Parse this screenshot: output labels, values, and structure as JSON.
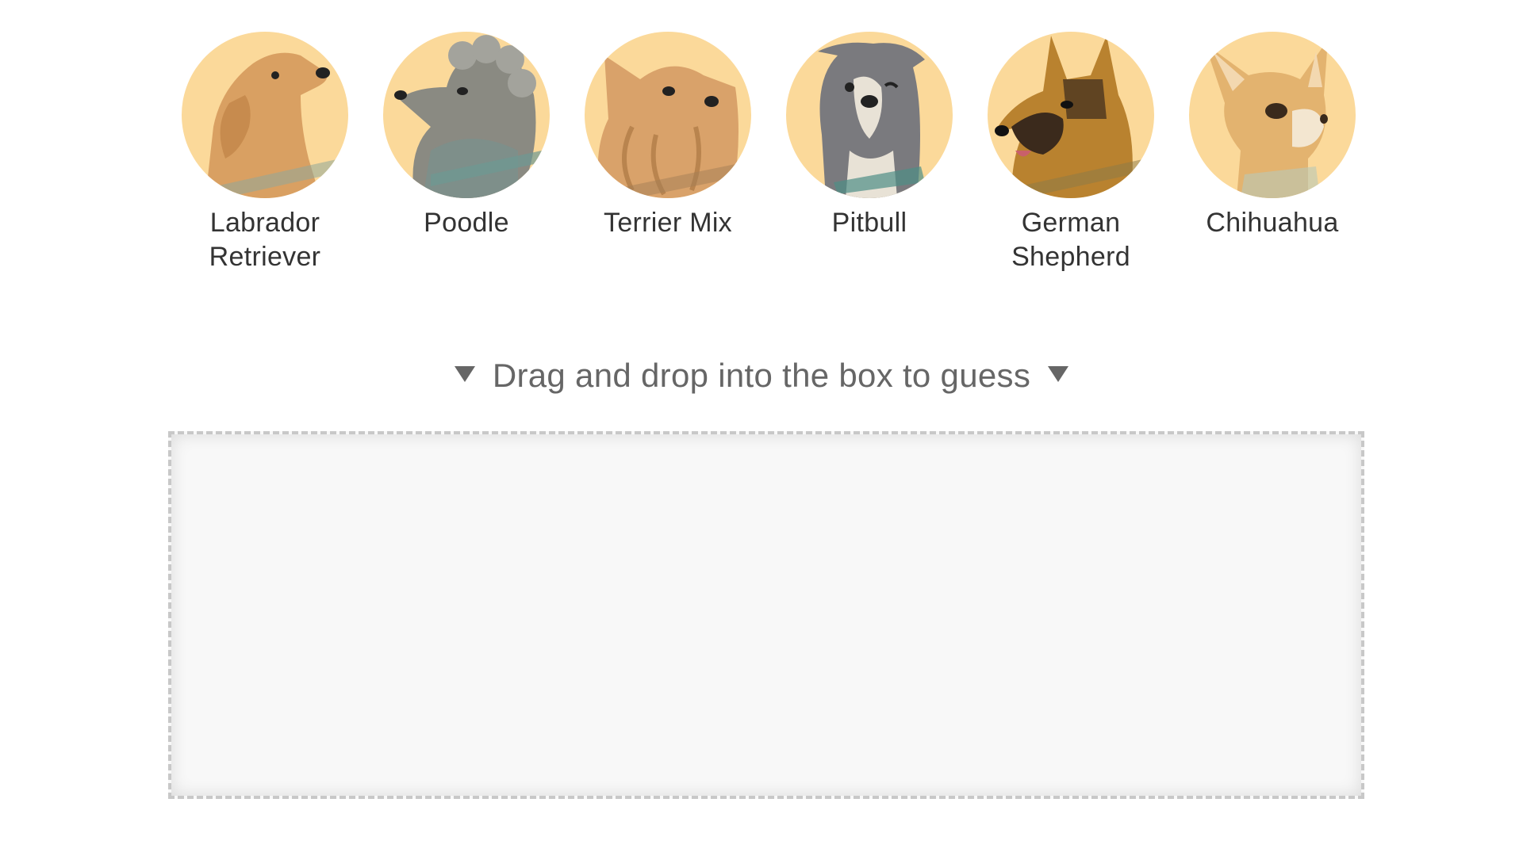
{
  "breeds": [
    {
      "id": "labrador",
      "label_line1": "Labrador",
      "label_line2": "Retriever",
      "icon": "labrador-retriever-portrait"
    },
    {
      "id": "poodle",
      "label_line1": "Poodle",
      "label_line2": "",
      "icon": "poodle-portrait"
    },
    {
      "id": "terrier",
      "label_line1": "Terrier Mix",
      "label_line2": "",
      "icon": "terrier-mix-portrait"
    },
    {
      "id": "pitbull",
      "label_line1": "Pitbull",
      "label_line2": "",
      "icon": "pitbull-portrait"
    },
    {
      "id": "german-shepherd",
      "label_line1": "German",
      "label_line2": "Shepherd",
      "icon": "german-shepherd-portrait"
    },
    {
      "id": "chihuahua",
      "label_line1": "Chihuahua",
      "label_line2": "",
      "icon": "chihuahua-portrait"
    }
  ],
  "instruction": {
    "text": "Drag and drop into the box to guess"
  },
  "colors": {
    "avatar_background": "#fbd99a",
    "label_text": "#333333",
    "instruction_text": "#666666",
    "dropzone_border": "#c8c8c8",
    "dropzone_fill": "#f8f8f8"
  }
}
